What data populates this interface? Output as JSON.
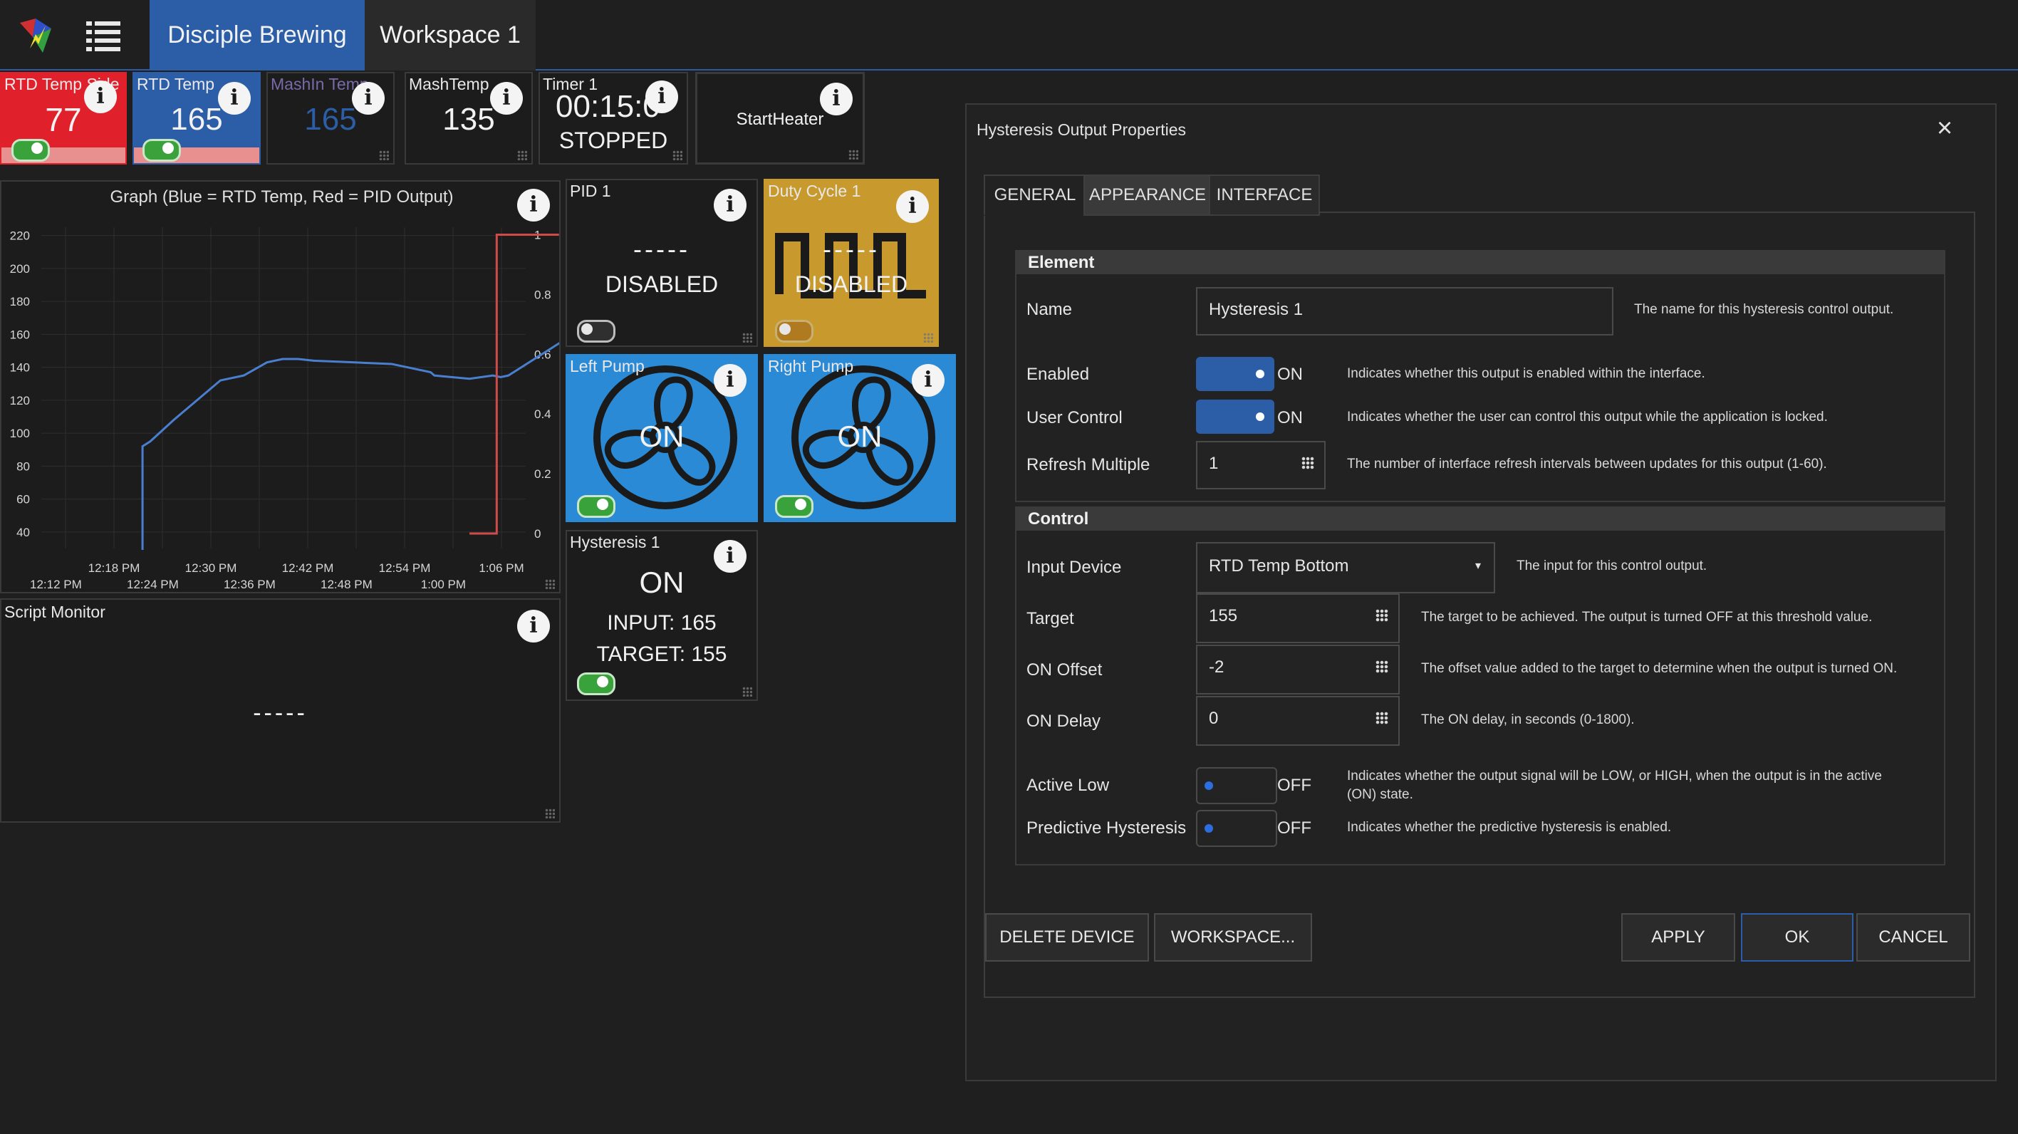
{
  "topbar": {
    "tabs": [
      "Disciple Brewing",
      "Workspace 1"
    ]
  },
  "tiles": {
    "rtd_side": {
      "label": "RTD Temp Side",
      "value": "77"
    },
    "rtd_temp": {
      "label": "RTD Temp",
      "value": "165"
    },
    "mashin": {
      "label": "MashIn Temp",
      "value": "165"
    },
    "mashtemp": {
      "label": "MashTemp",
      "value": "135"
    },
    "timer": {
      "label": "Timer 1",
      "value": "00:15:0",
      "state": "STOPPED"
    },
    "startheater": {
      "label": "StartHeater"
    },
    "pid": {
      "label": "PID 1",
      "value": "-----",
      "state": "DISABLED"
    },
    "duty": {
      "label": "Duty Cycle 1",
      "value": "-----",
      "state": "DISABLED"
    },
    "left_pump": {
      "label": "Left Pump",
      "state": "ON"
    },
    "right_pump": {
      "label": "Right Pump",
      "state": "ON"
    },
    "hysteresis": {
      "label": "Hysteresis 1",
      "state": "ON",
      "input": "INPUT: 165",
      "target": "TARGET: 155"
    },
    "script": {
      "label": "Script Monitor",
      "value": "-----"
    }
  },
  "graph": {
    "title": "Graph (Blue = RTD Temp, Red = PID Output)"
  },
  "chart_data": {
    "type": "line",
    "title": "Graph (Blue = RTD Temp, Red = PID Output)",
    "x_ticks_top": [
      "12:18 PM",
      "12:30 PM",
      "12:42 PM",
      "12:54 PM",
      "1:06 PM"
    ],
    "x_ticks_bottom": [
      "12:12 PM",
      "12:24 PM",
      "12:36 PM",
      "12:48 PM",
      "1:00 PM"
    ],
    "y_ticks_left": [
      "220",
      "200",
      "180",
      "160",
      "140",
      "120",
      "100",
      "80",
      "60",
      "40"
    ],
    "y_ticks_right": [
      "1",
      "0.8",
      "0.6",
      "0.4",
      "0.2",
      "0"
    ],
    "ylim_left": [
      30,
      225
    ],
    "ylim_right": [
      -0.05,
      1.025
    ],
    "xlim_min": [
      0,
      56
    ],
    "series": [
      {
        "name": "RTD Temp",
        "color": "#4a7fd0",
        "axis": "left",
        "x": [
          13,
          13,
          14,
          17,
          20,
          23,
          26,
          29,
          31,
          33,
          35,
          40,
          45,
          50,
          50.5,
          55,
          58,
          59,
          60,
          61,
          64,
          67,
          70,
          71
        ],
        "y": [
          15,
          92,
          95,
          108,
          120,
          132,
          135,
          143,
          145,
          145,
          144,
          143,
          142,
          137,
          135,
          133,
          135,
          134,
          135,
          138,
          147,
          156,
          162,
          166
        ]
      },
      {
        "name": "PID Output",
        "color": "#d04a4a",
        "axis": "right",
        "x": [
          55,
          58.5,
          58.5,
          66.5
        ],
        "y": [
          0,
          0,
          1,
          1
        ]
      }
    ]
  },
  "dialog": {
    "title": "Hysteresis Output Properties",
    "close": "×",
    "tabs": [
      "GENERAL",
      "APPEARANCE",
      "INTERFACE"
    ],
    "element_header": "Element",
    "control_header": "Control",
    "name_label": "Name",
    "name_value": "Hysteresis 1",
    "name_desc": "The name for this hysteresis control output.",
    "enabled_label": "Enabled",
    "enabled_state": "ON",
    "enabled_desc": "Indicates whether this output is enabled within the interface.",
    "user_label": "User Control",
    "user_state": "ON",
    "user_desc": "Indicates whether the user can control this output while the application is locked.",
    "refresh_label": "Refresh Multiple",
    "refresh_value": "1",
    "refresh_desc": "The number of interface refresh intervals between updates for this output (1-60).",
    "input_label": "Input Device",
    "input_value": "RTD Temp Bottom",
    "input_desc": "The input for this control output.",
    "target_label": "Target",
    "target_value": "155",
    "target_desc": "The target to be achieved. The output is turned OFF at this threshold value.",
    "onoffset_label": "ON Offset",
    "onoffset_value": "-2",
    "onoffset_desc": "The offset value added to the target to determine when the output is turned ON.",
    "ondelay_label": "ON Delay",
    "ondelay_value": "0",
    "ondelay_desc": "The ON delay, in seconds (0-1800).",
    "activelow_label": "Active Low",
    "activelow_state": "OFF",
    "activelow_desc1": "Indicates whether the output signal will be LOW, or HIGH, when the output is in the active",
    "activelow_desc2": "(ON) state.",
    "predictive_label": "Predictive Hysteresis",
    "predictive_state": "OFF",
    "predictive_desc": "Indicates whether the predictive hysteresis is enabled.",
    "buttons": {
      "delete": "DELETE DEVICE",
      "workspace": "WORKSPACE...",
      "apply": "APPLY",
      "ok": "OK",
      "cancel": "CANCEL"
    }
  }
}
